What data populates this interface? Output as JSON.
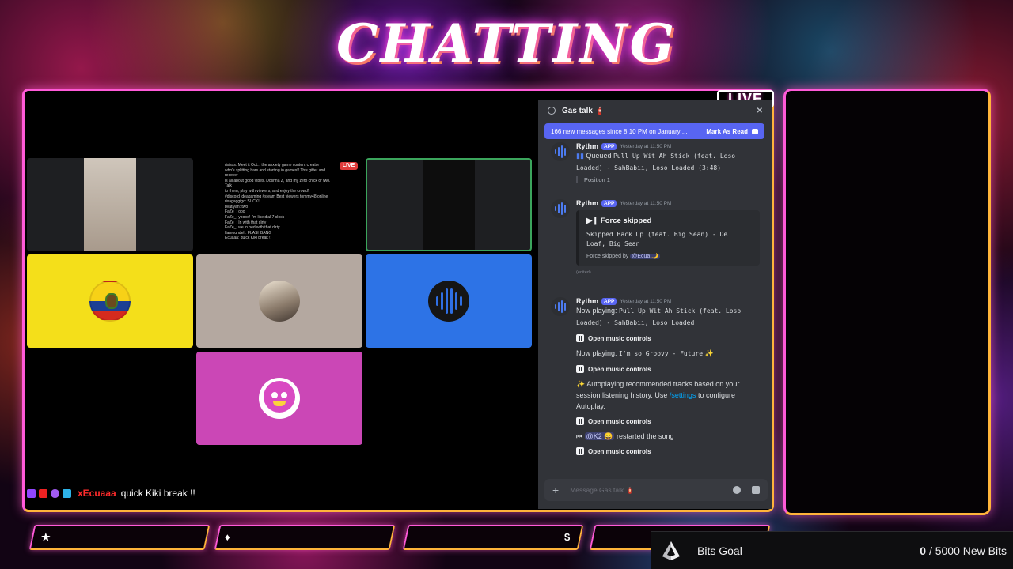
{
  "overlay": {
    "title": "CHATTING",
    "live_badge": "LIVE"
  },
  "call_grid": {
    "mini_live_badge": "LIVE",
    "mini_chat_lines": [
      "rixisss: Meet it Oct... the anxiety game content creator",
      "who's splitting bars and starting in games!! This gifter and recover",
      "is all about good vibes. Doshna Z, and my zero chick or two. Talk",
      "to them, play with viewers, and enjoy the crowd!",
      "#discord ideagaming #steam Best viewers tommy48.online",
      "rixagaggigc: SUCK!!",
      "bvatlyan: two",
      "FaZe_: ooo",
      "FaZe_: yoooo! I'm like dial 7 clock",
      "FaZe_: In with that dirty",
      "FaZe_: we in bed with that dirty",
      "flamoundeh: FLASHBANG",
      "Ecuaaa: quick Kiki break !!"
    ]
  },
  "discord": {
    "channel_name": "Gas talk 🧯",
    "close_icon": "✕",
    "new_messages_banner": "166 new messages since 8:10 PM on January ...",
    "mark_as_read": "Mark As Read",
    "messages": [
      {
        "user": "Rythm",
        "badge": "APP",
        "timestamp": "Yesterday at 11:50 PM",
        "prefix": "Queued",
        "track": "Pull Up Wit Ah Stick (feat. Loso Loaded) - SahBabii, Loso Loaded (3:48)",
        "sub": "Position 1"
      },
      {
        "user": "Rythm",
        "badge": "APP",
        "timestamp": "Yesterday at 11:50 PM",
        "embed_title": "Force skipped",
        "embed_text": "Skipped Back Up (feat. Big Sean) - DeJ Loaf, Big Sean",
        "embed_footer_prefix": "Force skipped by",
        "embed_footer_mention": "@Ecua 🌙",
        "edited_note": "(edited)"
      },
      {
        "user": "Rythm",
        "badge": "APP",
        "timestamp": "Yesterday at 11:50 PM",
        "now_playing_1_prefix": "Now playing:",
        "now_playing_1_track": "Pull Up Wit Ah Stick (feat. Loso Loaded) - SahBabii, Loso Loaded",
        "music_controls": "Open music controls",
        "now_playing_2_prefix": "Now playing:",
        "now_playing_2_track": "I'm so Groovy - Future",
        "sparkle": "✨",
        "autoplay_text_1": "✨ Autoplaying recommended tracks based on your session listening history. Use",
        "autoplay_command": "/settings",
        "autoplay_text_2": "to configure Autoplay.",
        "restart_mention": "@K2 😀",
        "restart_text": "restarted the song"
      }
    ],
    "input_placeholder": "Message Gas talk 🧯"
  },
  "stream_chat": {
    "username": "xEcuaaa",
    "message": "quick Kiki break !!"
  },
  "bottom_bar": {
    "box_icons": [
      "★",
      "♦",
      "$"
    ],
    "bits_goal_label": "Bits Goal",
    "bits_current": "0",
    "bits_target": " / 5000 New Bits"
  },
  "colors": {
    "frame_pink": "#ff5ad8",
    "frame_orange": "#ffb43a",
    "discord_bg": "#313338",
    "blurple": "#5865f2",
    "tile_yellow": "#f4df1a",
    "tile_taupe": "#b4a8a0",
    "tile_blue": "#2d73e6",
    "tile_pink": "#cb47b6"
  }
}
